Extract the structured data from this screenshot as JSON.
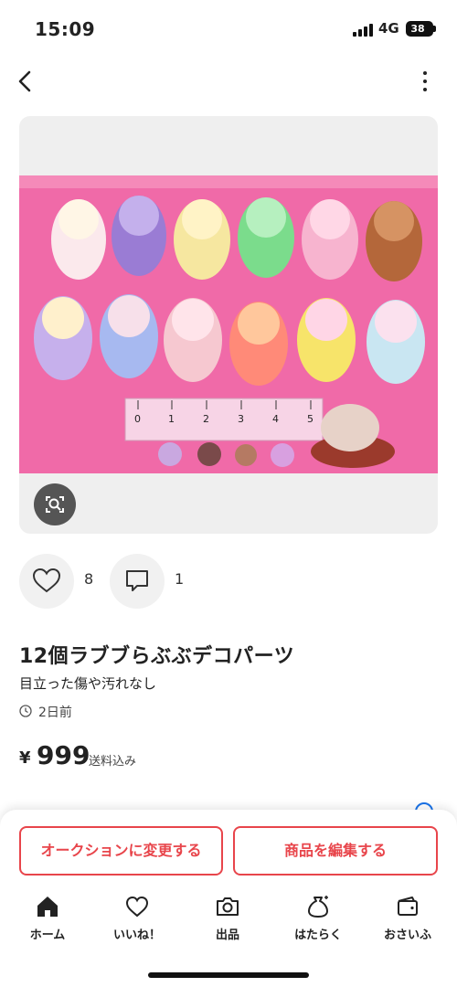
{
  "status_bar": {
    "time": "15:09",
    "network": "4G",
    "battery": "38"
  },
  "nav": {
    "back_icon": "chevron-left-icon",
    "more_icon": "vertical-dots-icon"
  },
  "product": {
    "title": "12個ラブブらぶぶデコパーツ",
    "condition": "目立った傷や汚れなし",
    "posted": "2日前",
    "currency": "¥",
    "price": "999",
    "shipping": "送料込み",
    "photo_ruler_numbers": [
      "0",
      "1",
      "2",
      "3",
      "4",
      "5"
    ]
  },
  "actions": {
    "likes": "8",
    "comments": "1"
  },
  "bottom_actions": {
    "auction_label": "オークションに変更する",
    "edit_label": "商品を編集する"
  },
  "tabs": [
    {
      "label": "ホーム",
      "icon": "home-icon"
    },
    {
      "label": "いいね！",
      "icon": "heart-icon"
    },
    {
      "label": "出品",
      "icon": "camera-icon"
    },
    {
      "label": "はたらく",
      "icon": "money-bag-icon"
    },
    {
      "label": "おさいふ",
      "icon": "wallet-icon"
    }
  ],
  "colors": {
    "accent": "#e8454b",
    "photo_background": "#f06aa8"
  }
}
